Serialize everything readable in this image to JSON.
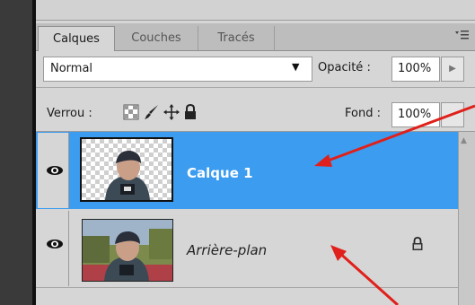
{
  "tabs": [
    "Calques",
    "Couches",
    "Tracés"
  ],
  "active_tab": "Calques",
  "blend_mode": {
    "value": "Normal"
  },
  "opacity": {
    "label": "Opacité :",
    "value": "100%"
  },
  "lock": {
    "label": "Verrou :"
  },
  "fill": {
    "label": "Fond :",
    "value": "100%"
  },
  "layers": [
    {
      "name": "Calque 1",
      "selected": true,
      "visible": true
    },
    {
      "name": "Arrière-plan",
      "selected": false,
      "visible": true,
      "locked": true
    }
  ],
  "colors": {
    "selection": "#3b9cf0",
    "annotation_arrow": "#e0201a",
    "panel": "#d6d6d6"
  },
  "icons": {
    "panel_menu": "panel-menu-icon",
    "lock_transparent": "lock-transparent-pixels-icon",
    "lock_image": "brush-icon",
    "lock_position": "move-icon",
    "lock_all": "lock-icon",
    "visibility": "eye-icon"
  }
}
